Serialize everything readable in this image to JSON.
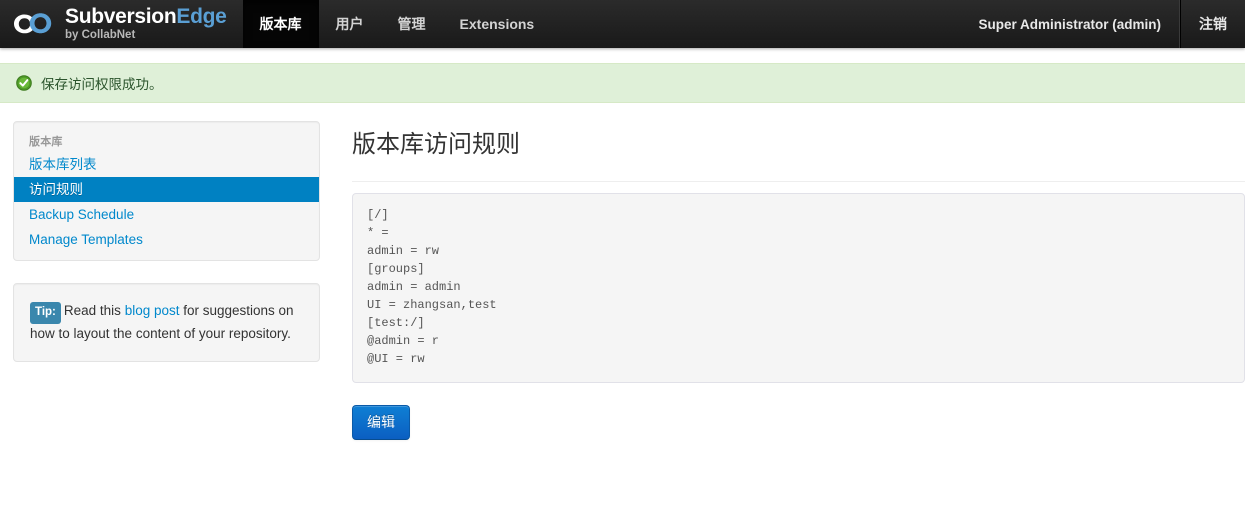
{
  "header": {
    "brand": {
      "icon": "collabnet-cloud-logo-icon",
      "title_part1": "Subversion",
      "title_part2": "Edge",
      "subtitle": "by CollabNet"
    },
    "tabs": [
      {
        "label": "版本库",
        "active": true
      },
      {
        "label": "用户",
        "active": false
      },
      {
        "label": "管理",
        "active": false
      },
      {
        "label": "Extensions",
        "active": false
      }
    ],
    "user_label": "Super Administrator (admin)",
    "logout_label": "注销",
    "bg_color": "#222222",
    "active_tab_color": "#050505"
  },
  "alert": {
    "icon": "success-check-icon",
    "message": "保存访问权限成功。",
    "bg_color": "#dff0d8",
    "border_color": "#d6e9c6",
    "text_color": "#2b542c"
  },
  "sidebar": {
    "group_header": "版本库",
    "items": [
      {
        "label": "版本库列表",
        "active": false
      },
      {
        "label": "访问规则",
        "active": true
      },
      {
        "label": "Backup Schedule",
        "active": false
      },
      {
        "label": "Manage Templates",
        "active": false
      }
    ],
    "active_color": "#0081c2",
    "link_color": "#0088cc"
  },
  "tip": {
    "badge": "Tip:",
    "text_before": "Read this",
    "link": "blog post",
    "text_after": "for suggestions on how to layout the content of your repository.",
    "badge_color": "#3a87ad"
  },
  "main": {
    "title": "版本库访问规则",
    "access_rules": "[/]\n* =\nadmin = rw\n[groups]\nadmin = admin\nUI = zhangsan,test\n[test:/]\n@admin = r\n@UI = rw",
    "edit_button": "编辑",
    "edit_button_color": "#0b6ecb"
  }
}
